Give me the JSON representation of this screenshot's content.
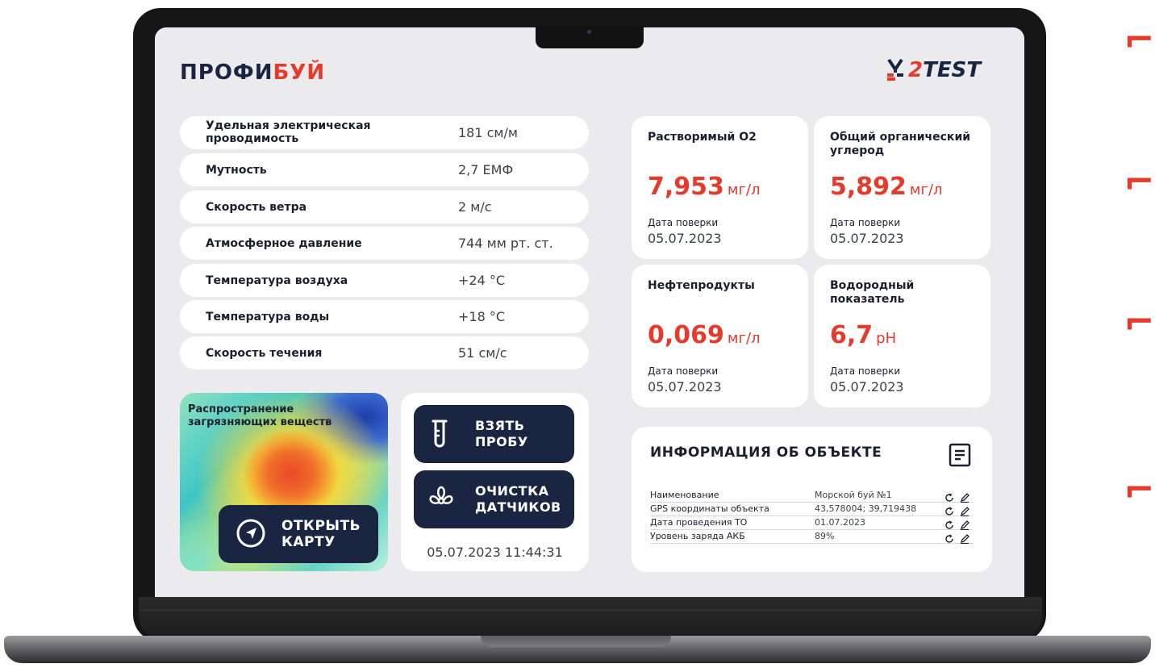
{
  "brand": {
    "logo_left_part1": "ПРОФИ",
    "logo_left_part2": "БУЙ",
    "logo_right_part1": "2",
    "logo_right_part2": "TEST"
  },
  "params": [
    {
      "label": "Удельная электрическая проводимость",
      "value": "181 см/м"
    },
    {
      "label": "Мутность",
      "value": "2,7 ЕМФ"
    },
    {
      "label": "Скорость ветра",
      "value": "2 м/с"
    },
    {
      "label": "Атмосферное давление",
      "value": "744 мм рт. ст."
    },
    {
      "label": "Температура воздуха",
      "value": "+24 °C"
    },
    {
      "label": "Температура воды",
      "value": "+18 °C"
    },
    {
      "label": "Скорость течения",
      "value": "51 см/с"
    }
  ],
  "map": {
    "title": "Распространение загрязняющих веществ",
    "button": "ОТКРЫТЬ КАРТУ"
  },
  "actions": {
    "sample_button": "ВЗЯТЬ ПРОБУ",
    "clean_button": "ОЧИСТКА ДАТЧИКОВ",
    "timestamp": "05.07.2023 11:44:31"
  },
  "sensors": [
    {
      "name": "Растворимый О2",
      "value": "7,953",
      "unit": "мг/л",
      "date_label": "Дата поверки",
      "date": "05.07.2023"
    },
    {
      "name": "Общий органический углерод",
      "value": "5,892",
      "unit": "мг/л",
      "date_label": "Дата поверки",
      "date": "05.07.2023"
    },
    {
      "name": "Нефтепродукты",
      "value": "0,069",
      "unit": "мг/л",
      "date_label": "Дата поверки",
      "date": "05.07.2023"
    },
    {
      "name": "Водородный показатель",
      "value": "6,7",
      "unit": "pH",
      "date_label": "Дата поверки",
      "date": "05.07.2023"
    }
  ],
  "info": {
    "title": "ИНФОРМАЦИЯ ОБ ОБЪЕКТЕ",
    "rows": [
      {
        "key": "Наименование",
        "value": "Морской буй №1"
      },
      {
        "key": "GPS координаты объекта",
        "value": "43,578004; 39,719438"
      },
      {
        "key": "Дата проведения ТО",
        "value": "01.07.2023"
      },
      {
        "key": "Уровень заряда АКБ",
        "value": "89%"
      }
    ]
  },
  "colors": {
    "accent": "#e53b2c",
    "navy": "#1a2542",
    "screen_bg": "#ebebed"
  },
  "icons": [
    "test-tube-icon",
    "fan-icon",
    "navigation-arrow-icon",
    "document-icon",
    "refresh-icon",
    "edit-pencil-icon"
  ]
}
